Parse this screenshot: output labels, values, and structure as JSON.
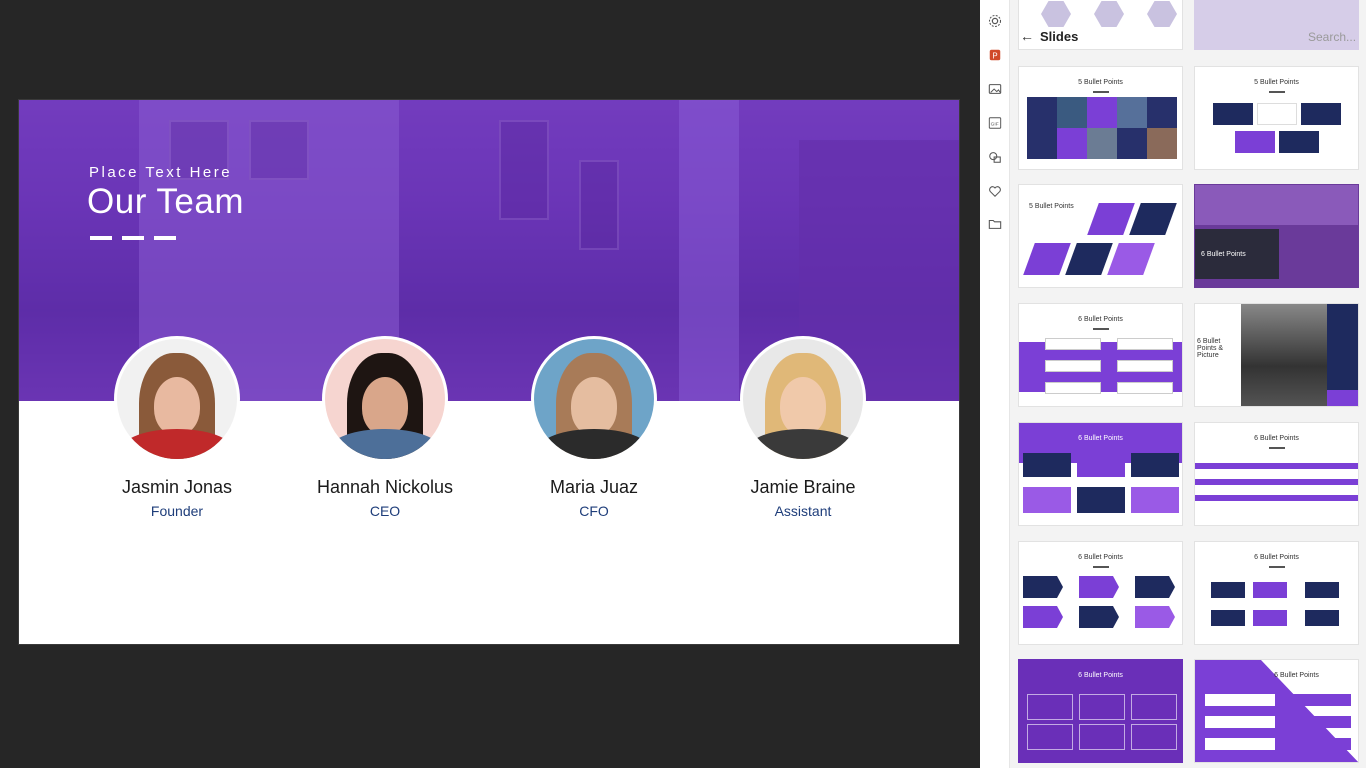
{
  "slide": {
    "kicker": "Place Text Here",
    "title": "Our Team",
    "members": [
      {
        "name": "Jasmin Jonas",
        "role": "Founder"
      },
      {
        "name": "Hannah Nickolus",
        "role": "CEO"
      },
      {
        "name": "Maria Juaz",
        "role": "CFO"
      },
      {
        "name": "Jamie Braine",
        "role": "Assistant"
      }
    ]
  },
  "sidebar": {
    "icons": [
      "gear-icon",
      "powerpoint-icon",
      "image-icon",
      "gif-icon",
      "shapes-icon",
      "heart-icon",
      "folder-icon"
    ]
  },
  "panel": {
    "title": "Slides",
    "search_placeholder": "Search...",
    "thumbs": [
      {
        "caption": "5 Bullet Points"
      },
      {
        "caption": "5 Bullet Points"
      },
      {
        "caption": "5 Bullet Points"
      },
      {
        "caption": "6 Bullet Points"
      },
      {
        "caption": "6 Bullet Points"
      },
      {
        "caption": "6 Bullet Points & Picture"
      },
      {
        "caption": "6 Bullet Points"
      },
      {
        "caption": "6 Bullet Points"
      },
      {
        "caption": "6 Bullet Points"
      },
      {
        "caption": "6 Bullet Points"
      },
      {
        "caption": "6 Bullet Points"
      },
      {
        "caption": "6 Bullet Points"
      }
    ]
  },
  "colors": {
    "accent": "#7b3fd6",
    "navy": "#1e2a5e",
    "role": "#1e3d7a"
  }
}
